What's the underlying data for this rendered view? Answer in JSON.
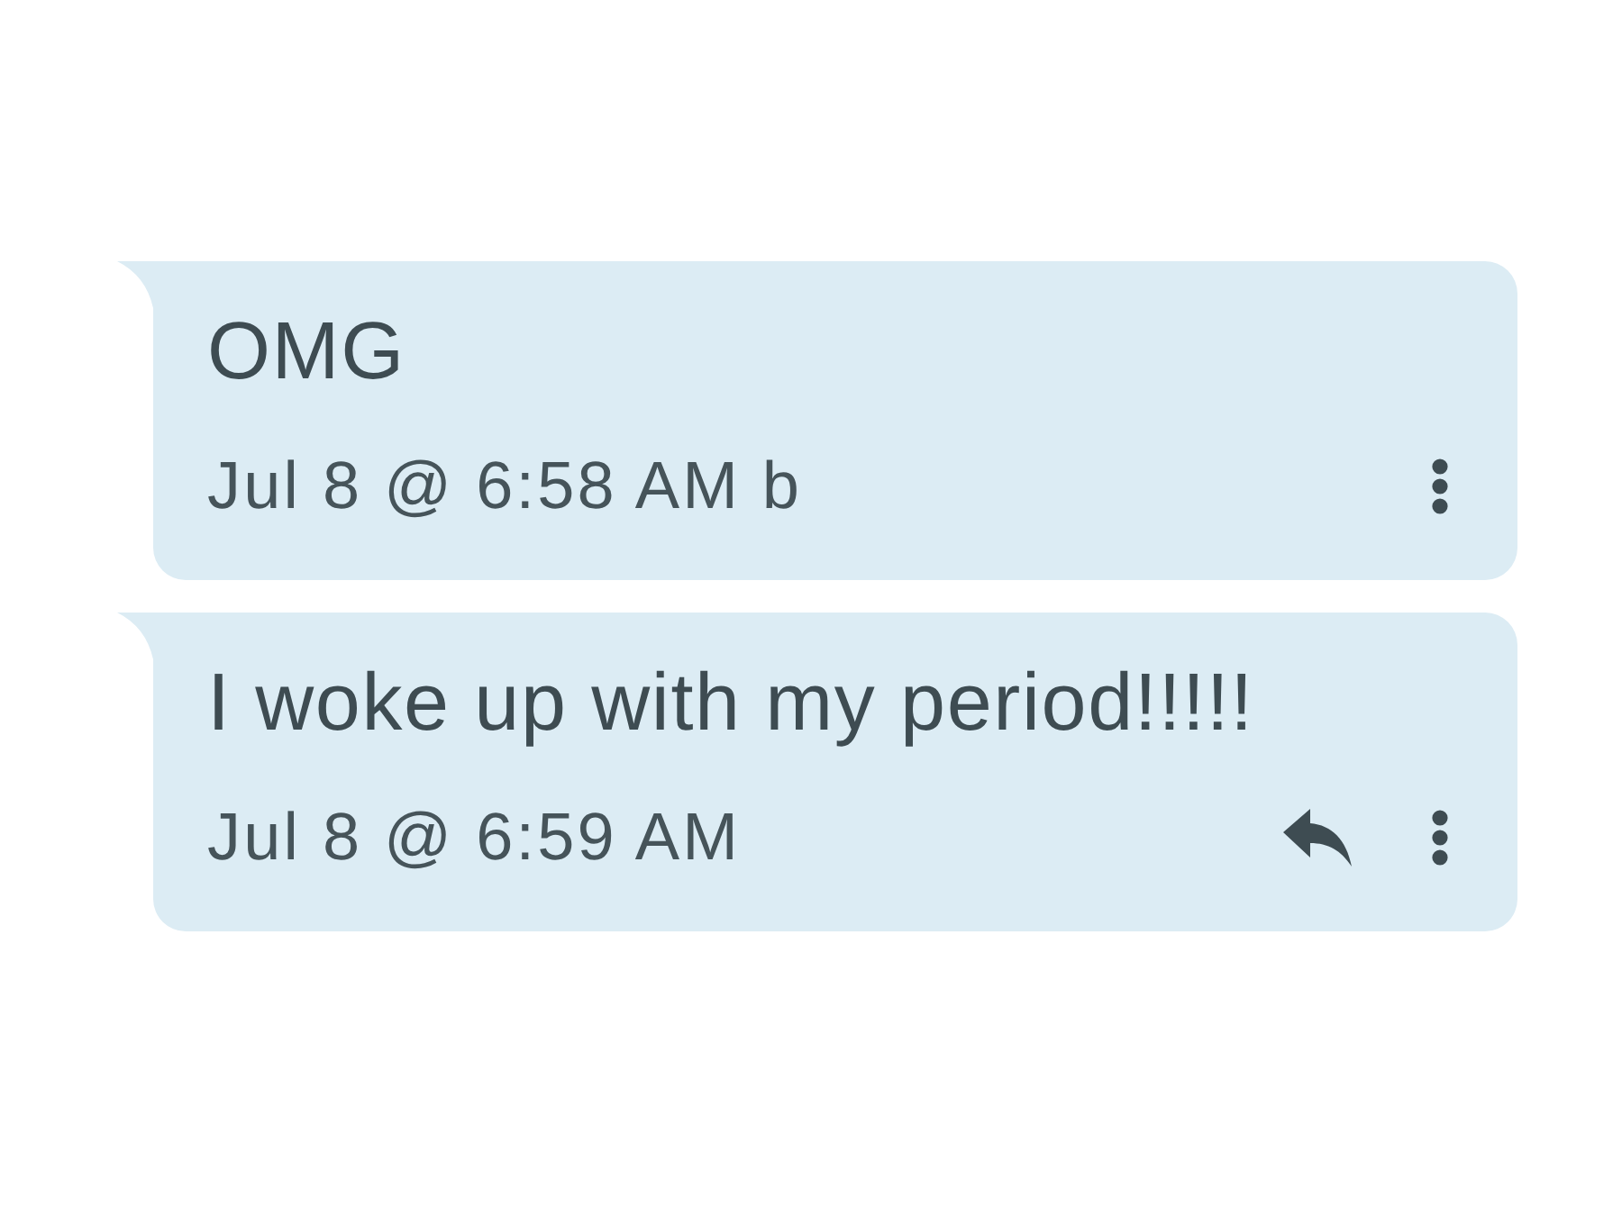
{
  "messages": [
    {
      "text": "OMG",
      "timestamp": "Jul 8 @ 6:58 AM b",
      "reply_button": false
    },
    {
      "text": "I woke up with my period!!!!!",
      "timestamp": "Jul 8 @ 6:59 AM",
      "reply_button": true
    }
  ]
}
